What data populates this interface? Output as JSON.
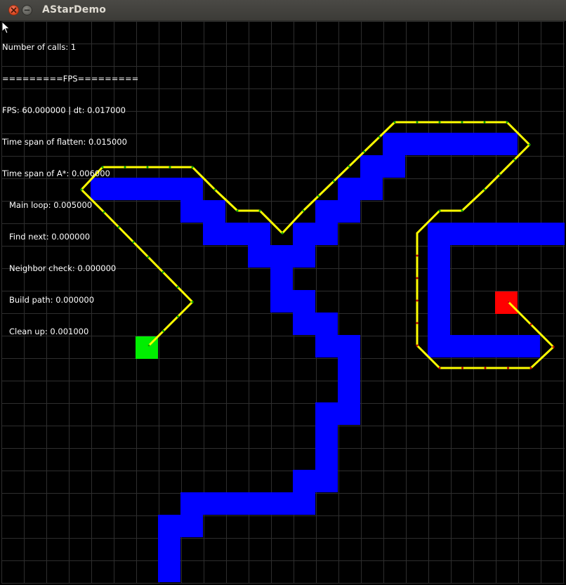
{
  "window": {
    "title": "AStarDemo",
    "close_icon": "close-icon",
    "minimize_icon": "minimize-icon"
  },
  "hud": {
    "calls": "Number of calls: 1",
    "fps_header": "=========FPS=========",
    "fps": "FPS: 60.000000 | dt: 0.017000",
    "flatten": "Time span of flatten: 0.015000",
    "astar": "Time span of A*: 0.006000",
    "main_loop": "Main loop: 0.005000",
    "find_next": "Find next: 0.000000",
    "neighbor_check": "Neighbor check: 0.000000",
    "build_path": "Build path: 0.000000",
    "clean_up": "Clean up: 0.001000"
  },
  "colors": {
    "background": "#000000",
    "grid": "#2e2e2e",
    "wall": "#0000ff",
    "start": "#00ee00",
    "goal": "#ff0000",
    "path": "#ffff00",
    "node_green": "#00aa00",
    "node_red": "#cc0000"
  },
  "cursor_icon": "arrow-cursor-icon"
}
